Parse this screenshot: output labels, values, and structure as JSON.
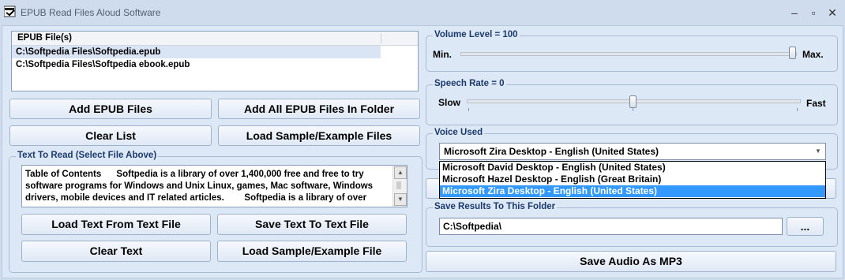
{
  "window": {
    "title": "EPUB Read Files Aloud Software",
    "minimize": "–",
    "maximize": "▫",
    "close": "✕"
  },
  "file_list": {
    "header": "EPUB File(s)",
    "rows": [
      "C:\\Softpedia Files\\Softpedia.epub",
      "C:\\Softpedia Files\\Softpedia ebook.epub"
    ]
  },
  "buttons": {
    "add_files": "Add EPUB Files",
    "add_folder": "Add All EPUB Files In Folder",
    "clear_list": "Clear List",
    "load_sample_files": "Load Sample/Example Files",
    "load_text_file": "Load Text From Text File",
    "save_text_file": "Save Text To Text File",
    "clear_text": "Clear Text",
    "load_sample_file": "Load Sample/Example File",
    "browse": "...",
    "save_mp3": "Save Audio As MP3"
  },
  "text_to_read": {
    "label": "Text To Read (Select File Above)",
    "content": "Table of Contents      Softpedia is a library of over 1,400,000 free and free to try software programs for Windows and Unix Linux, games, Mac software, Windows drivers, mobile devices and IT related articles.        Softpedia is a library of over"
  },
  "volume": {
    "label": "Volume Level = 100",
    "min_label": "Min.",
    "max_label": "Max.",
    "value": 100
  },
  "speech_rate": {
    "label": "Speech Rate = 0",
    "slow_label": "Slow",
    "fast_label": "Fast",
    "value": 0
  },
  "voice": {
    "label": "Voice Used",
    "selected": "Microsoft Zira Desktop - English (United States)",
    "options": [
      "Microsoft David Desktop - English (United States)",
      "Microsoft Hazel Desktop - English (Great Britain)",
      "Microsoft Zira Desktop - English (United States)"
    ]
  },
  "save_folder": {
    "label": "Save Results To This Folder",
    "value": "C:\\Softpedia\\"
  }
}
